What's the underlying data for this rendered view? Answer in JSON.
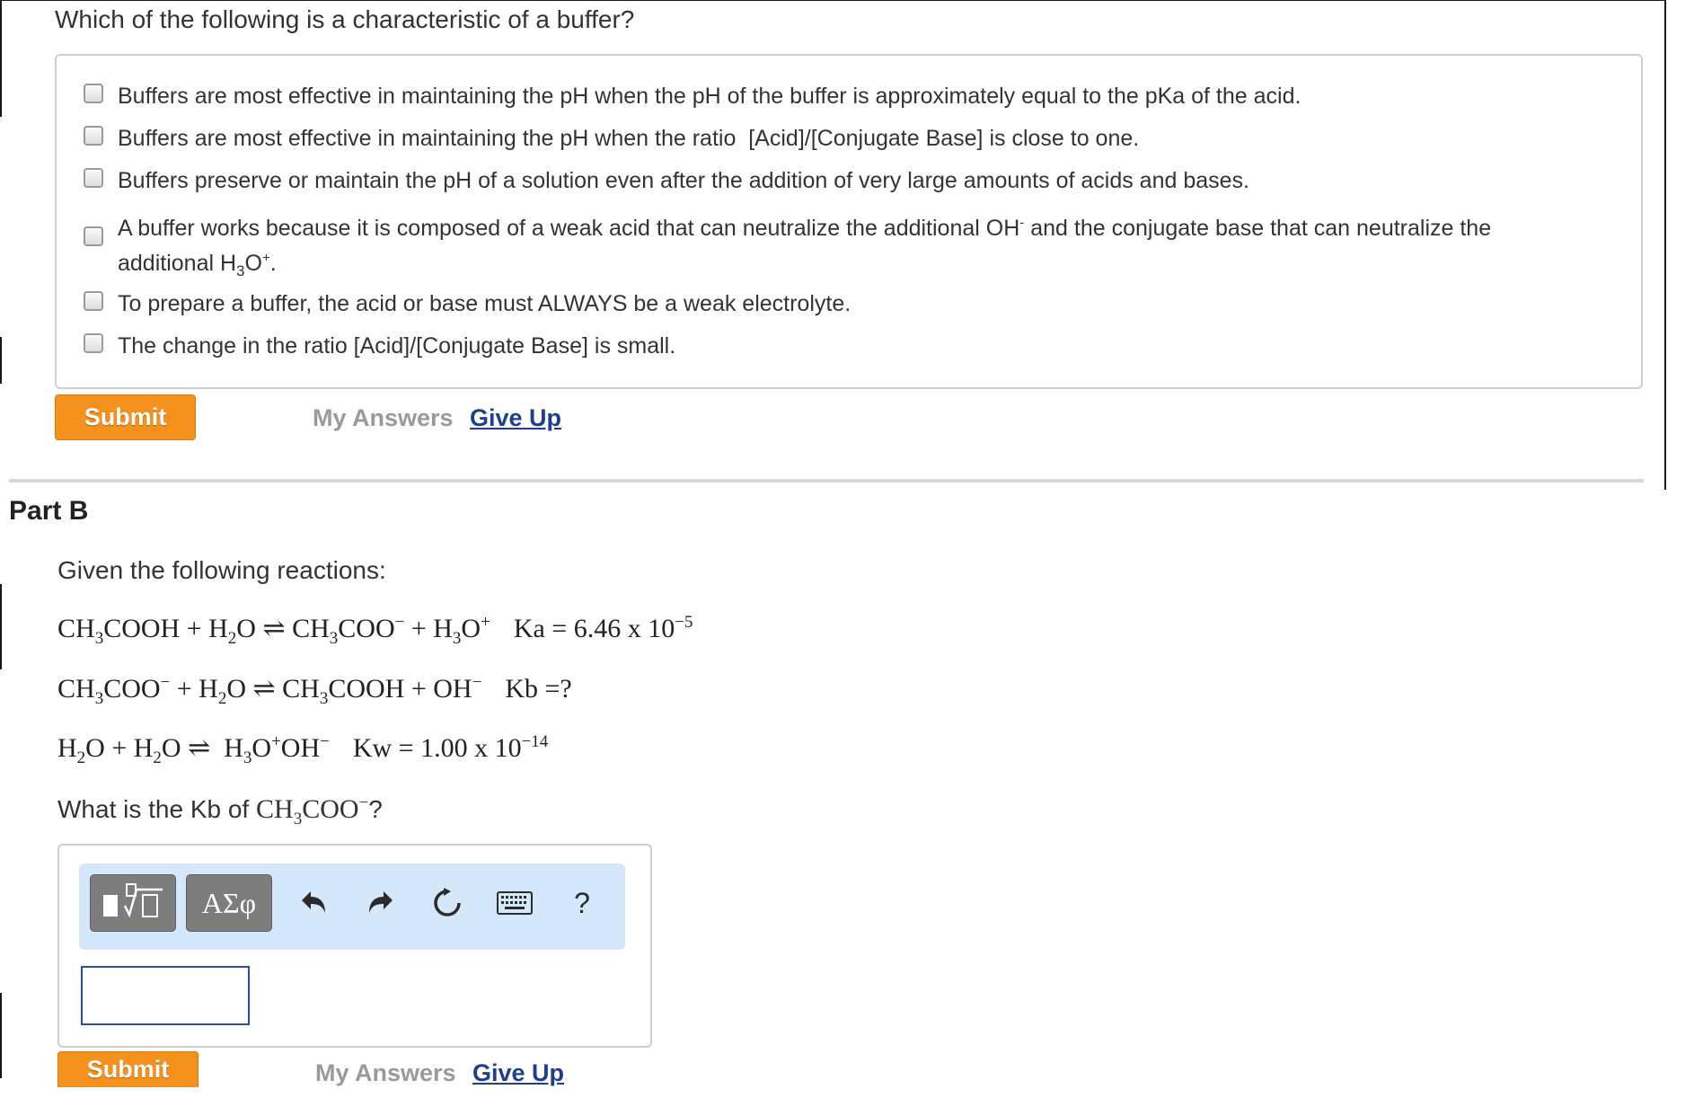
{
  "partA": {
    "question": "Which of the following is a characteristic of a buffer?",
    "options": [
      {
        "text": "Buffers are most effective in maintaining the pH when the pH of the buffer is approximately equal to the pKa of the acid.",
        "checked": false
      },
      {
        "text": "Buffers are most effective in maintaining the pH when the ratio  [Acid]/[Conjugate Base] is close to one.",
        "checked": false
      },
      {
        "text": "Buffers preserve or maintain the pH of a solution even after the addition of very large amounts of acids and bases.",
        "checked": false
      },
      {
        "text_part1": "A buffer works because it is composed of a weak acid that can neutralize the additional OH",
        "sup1": "-",
        "text_part2": " and the conjugate base that can neutralize the",
        "text_line2_a": "additional H",
        "sub2": "3",
        "text_line2_b": "O",
        "sup2": "+",
        "text_line2_c": ".",
        "checked": false
      },
      {
        "text": "To prepare a buffer, the acid or base must ALWAYS be a weak electrolyte.",
        "checked": false
      },
      {
        "text": "The change in the ratio [Acid]/[Conjugate Base] is small.",
        "checked": false
      }
    ],
    "submit_label": "Submit",
    "my_answers_label": "My Answers",
    "give_up_label": "Give Up"
  },
  "partB": {
    "title": "Part B",
    "intro": "Given the following reactions:",
    "eq1": {
      "a": "CH",
      "a_sub": "3",
      "b": "COOH + H",
      "b_sub": "2",
      "c": "O ⇌ CH",
      "c_sub": "3",
      "d": "COO",
      "d_sup": "−",
      "e": " + H",
      "e_sub": "3",
      "f": "O",
      "f_sup": "+",
      "k": "Ka = 6.46 x 10",
      "k_sup": "−5"
    },
    "eq2": {
      "a": "CH",
      "a_sub": "3",
      "b": "COO",
      "b_sup": "−",
      "c": " + H",
      "c_sub": "2",
      "d": "O ⇌ CH",
      "d_sub": "3",
      "e": "COOH + OH",
      "e_sup": "−",
      "k": "Kb =?"
    },
    "eq3": {
      "a": "H",
      "a_sub": "2",
      "b": "O + H",
      "b_sub": "2",
      "c": "O ⇌  H",
      "c_sub": "3",
      "d": "O",
      "d_sup": "+",
      "e": "OH",
      "e_sup": "−",
      "k": "Kw = 1.00 x 10",
      "k_sup": "−14"
    },
    "question_a": "What is the Kb of ",
    "question_b": "CH",
    "question_b_sub": "3",
    "question_c": "COO",
    "question_c_sup": "−",
    "question_d": "?",
    "toolbar": {
      "greek_label": "ΑΣφ",
      "help_label": "?",
      "icons": [
        "templates-icon",
        "undo-icon",
        "redo-icon",
        "reset-icon",
        "keyboard-icon",
        "help-icon"
      ]
    },
    "answer_value": "",
    "submit_label": "Submit",
    "my_answers_label": "My Answers",
    "give_up_label": "Give Up"
  },
  "colors": {
    "submit": "#f5921e",
    "link": "#1e3f8f",
    "toolbar_bg": "#d5e8fb",
    "input_border": "#2a4d9c"
  }
}
